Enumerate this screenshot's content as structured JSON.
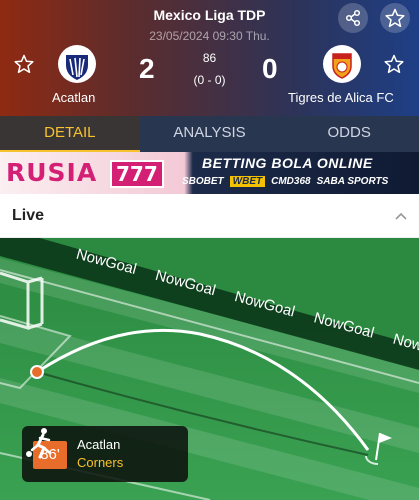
{
  "header": {
    "league": "Mexico Liga TDP",
    "datetime": "23/05/2024 09:30 Thu.",
    "home_team": "Acatlan",
    "away_team": "Tigres de Alica FC",
    "home_score": "2",
    "away_score": "0",
    "minute": "86",
    "half_time": "(0 - 0)"
  },
  "tabs": [
    {
      "label": "DETAIL",
      "active": true
    },
    {
      "label": "ANALYSIS",
      "active": false
    },
    {
      "label": "ODDS",
      "active": false
    }
  ],
  "banner": {
    "brand": "RUSIA",
    "brand_number": "777",
    "headline": "BETTING BOLA ONLINE",
    "sponsors": [
      "SBOBET",
      "WBET",
      "CMD368",
      "SABA SPORTS"
    ]
  },
  "live": {
    "label": "Live"
  },
  "pitch": {
    "watermark": "NowGoal",
    "event": {
      "minute": "86'",
      "team": "Acatlan",
      "type": "Corners"
    }
  },
  "colors": {
    "accent": "#f6c22d",
    "tab_bar": "#293650",
    "pitch": "#2f9546",
    "event_minute": "#e86d2a"
  },
  "icons": [
    "share-icon",
    "star-icon",
    "chevron-up-icon",
    "corner-kick-icon"
  ]
}
